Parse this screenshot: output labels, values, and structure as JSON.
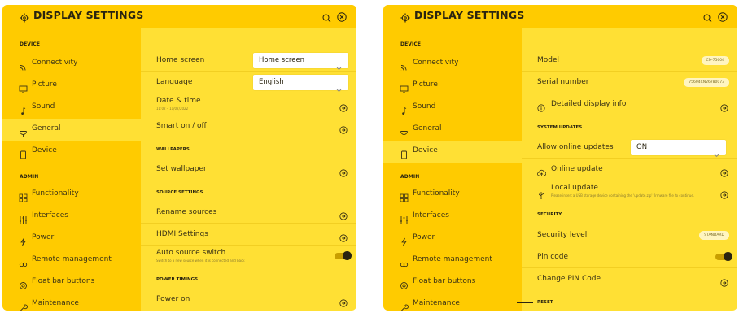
{
  "colors": {
    "window_bg": "#ffe034",
    "sidebar_bg": "#ffcb00",
    "text": "#2a2410",
    "accent_toggle": "#2a2410"
  },
  "left": {
    "title": "DISPLAY SETTINGS",
    "device_header": "DEVICE",
    "admin_header": "ADMIN",
    "nav_device": [
      {
        "label": "Connectivity",
        "icon": "wifi-icon"
      },
      {
        "label": "Picture",
        "icon": "monitor-icon"
      },
      {
        "label": "Sound",
        "icon": "music-note-icon"
      },
      {
        "label": "General",
        "icon": "antenna-icon",
        "active": true
      },
      {
        "label": "Device",
        "icon": "tablet-icon"
      }
    ],
    "nav_admin": [
      {
        "label": "Functionality",
        "icon": "grid-icon"
      },
      {
        "label": "Interfaces",
        "icon": "sliders-icon"
      },
      {
        "label": "Power",
        "icon": "bolt-icon"
      },
      {
        "label": "Remote management",
        "icon": "link-icon"
      },
      {
        "label": "Float bar buttons",
        "icon": "settings-icon"
      },
      {
        "label": "Maintenance",
        "icon": "wrench-icon"
      }
    ],
    "home_screen": {
      "label": "Home screen",
      "value": "Home screen"
    },
    "language": {
      "label": "Language",
      "value": "English"
    },
    "date_time": {
      "label": "Date & time",
      "sub": "11:02 – 11/02/2022"
    },
    "smart_onoff": {
      "label": "Smart on / off"
    },
    "wallpapers_header": "WALLPAPERS",
    "set_wallpaper": {
      "label": "Set wallpaper"
    },
    "source_settings_header": "SOURCE SETTINGS",
    "rename_sources": {
      "label": "Rename sources"
    },
    "hdmi_settings": {
      "label": "HDMI Settings"
    },
    "auto_source": {
      "label": "Auto source switch",
      "sub": "Switch to a new source when it is connected and back",
      "on": true
    },
    "power_timings_header": "POWER TIMINGS",
    "power_on": {
      "label": "Power on"
    }
  },
  "right": {
    "title": "DISPLAY SETTINGS",
    "device_header": "DEVICE",
    "admin_header": "ADMIN",
    "nav_device": [
      {
        "label": "Connectivity",
        "icon": "wifi-icon"
      },
      {
        "label": "Picture",
        "icon": "monitor-icon"
      },
      {
        "label": "Sound",
        "icon": "music-note-icon"
      },
      {
        "label": "General",
        "icon": "antenna-icon"
      },
      {
        "label": "Device",
        "icon": "tablet-icon",
        "active": true
      }
    ],
    "nav_admin": [
      {
        "label": "Functionality",
        "icon": "grid-icon"
      },
      {
        "label": "Interfaces",
        "icon": "sliders-icon"
      },
      {
        "label": "Power",
        "icon": "bolt-icon"
      },
      {
        "label": "Remote management",
        "icon": "link-icon"
      },
      {
        "label": "Float bar buttons",
        "icon": "settings-icon"
      },
      {
        "label": "Maintenance",
        "icon": "wrench-icon"
      }
    ],
    "model": {
      "label": "Model",
      "value": "CN-75604"
    },
    "serial": {
      "label": "Serial number",
      "value": "75604CN26780073"
    },
    "detailed_info": {
      "label": "Detailed display info"
    },
    "system_updates_header": "SYSTEM UPDATES",
    "allow_online": {
      "label": "Allow online updates",
      "value": "ON"
    },
    "online_update": {
      "label": "Online update"
    },
    "local_update": {
      "label": "Local update",
      "sub": "Please insert a USB storage device containing the 'update.zip' firmware file to continue."
    },
    "security_header": "SECURITY",
    "security_level": {
      "label": "Security level",
      "value": "STANDARD"
    },
    "pin_code": {
      "label": "Pin code",
      "on": true
    },
    "change_pin": {
      "label": "Change PIN Code"
    },
    "reset_header": "RESET"
  }
}
